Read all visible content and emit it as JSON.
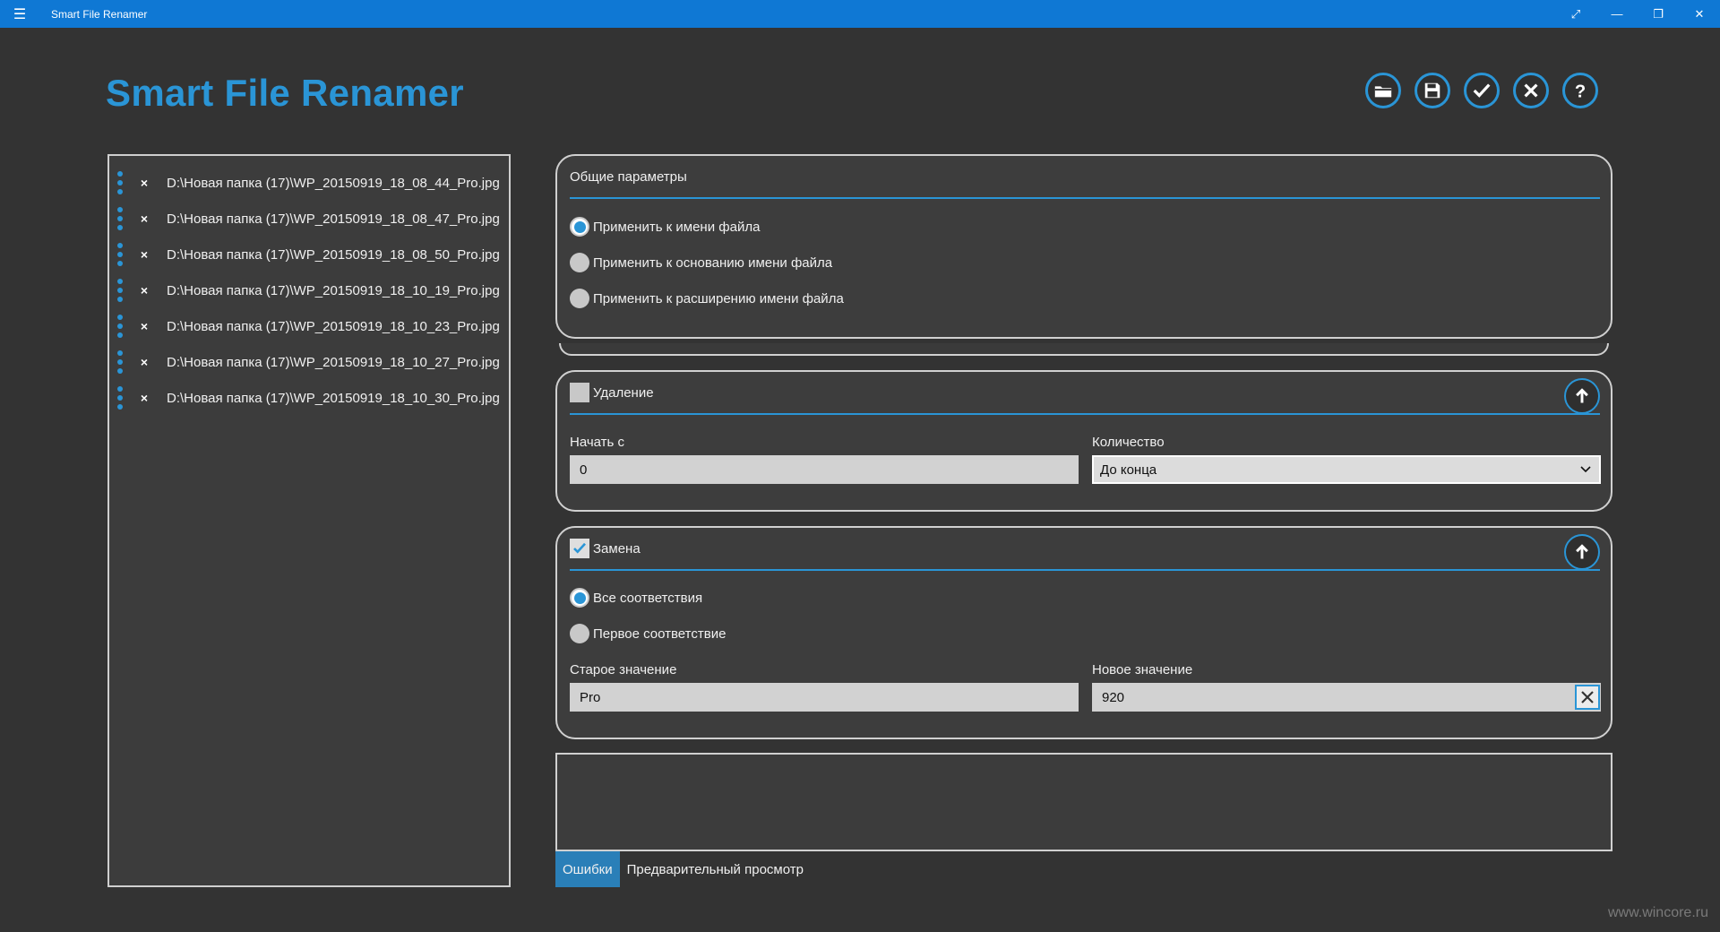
{
  "window": {
    "title": "Smart File Renamer",
    "menu_icon": "hamburger-icon",
    "buttons": [
      "fullscreen-icon",
      "minimize-icon",
      "restore-icon",
      "close-icon"
    ]
  },
  "app_title": "Smart File Renamer",
  "toolbar": {
    "buttons": [
      {
        "name": "open-folder-button",
        "icon": "folder-icon"
      },
      {
        "name": "save-button",
        "icon": "save-icon"
      },
      {
        "name": "apply-button",
        "icon": "checkmark-icon"
      },
      {
        "name": "cancel-button",
        "icon": "close-icon"
      },
      {
        "name": "help-button",
        "icon": "question-icon"
      }
    ]
  },
  "files": [
    "D:\\Новая папка (17)\\WP_20150919_18_08_44_Pro.jpg",
    "D:\\Новая папка (17)\\WP_20150919_18_08_47_Pro.jpg",
    "D:\\Новая папка (17)\\WP_20150919_18_08_50_Pro.jpg",
    "D:\\Новая папка (17)\\WP_20150919_18_10_19_Pro.jpg",
    "D:\\Новая папка (17)\\WP_20150919_18_10_23_Pro.jpg",
    "D:\\Новая папка (17)\\WP_20150919_18_10_27_Pro.jpg",
    "D:\\Новая папка (17)\\WP_20150919_18_10_30_Pro.jpg"
  ],
  "general": {
    "title": "Общие параметры",
    "options": [
      {
        "label": "Применить к имени файла",
        "selected": true
      },
      {
        "label": "Применить к основанию имени файла",
        "selected": false
      },
      {
        "label": "Применить к расширению имени файла",
        "selected": false
      }
    ]
  },
  "delete_panel": {
    "title": "Удаление",
    "checked": false,
    "start_label": "Начать с",
    "start_value": "0",
    "count_label": "Количество",
    "count_value": "До конца"
  },
  "replace_panel": {
    "title": "Замена",
    "checked": true,
    "options": [
      {
        "label": "Все соответствия",
        "selected": true
      },
      {
        "label": "Первое соответствие",
        "selected": false
      }
    ],
    "old_label": "Старое значение",
    "old_value": "Pro",
    "new_label": "Новое значение",
    "new_value": "920"
  },
  "tabs": [
    {
      "label": "Ошибки",
      "active": true
    },
    {
      "label": "Предварительный просмотр",
      "active": false
    }
  ],
  "watermark": "www.wincore.ru",
  "colors": {
    "accent": "#2a95d6",
    "titlebar": "#0f78d4",
    "background": "#333333"
  }
}
